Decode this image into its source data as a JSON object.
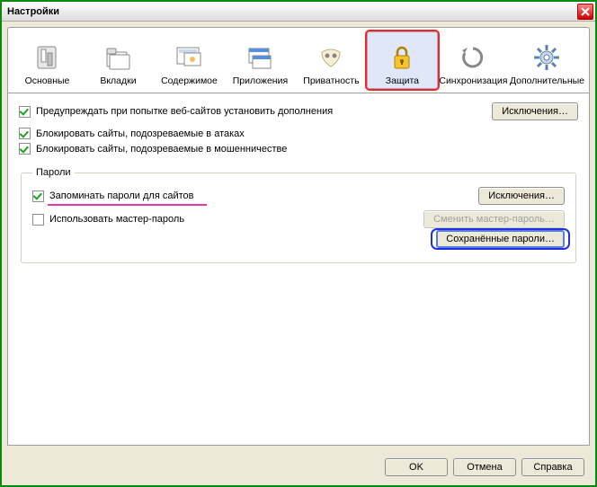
{
  "window": {
    "title": "Настройки"
  },
  "tabs": [
    {
      "label": "Основные"
    },
    {
      "label": "Вкладки"
    },
    {
      "label": "Содержимое"
    },
    {
      "label": "Приложения"
    },
    {
      "label": "Приватность"
    },
    {
      "label": "Защита"
    },
    {
      "label": "Синхронизация"
    },
    {
      "label": "Дополнительные"
    }
  ],
  "general": {
    "warn_addons": "Предупреждать при попытке веб-сайтов установить дополнения",
    "exceptions": "Исключения…",
    "block_attack": "Блокировать сайты, подозреваемые в атаках",
    "block_fraud": "Блокировать сайты, подозреваемые в мошенничестве"
  },
  "passwords": {
    "legend": "Пароли",
    "remember": "Запоминать пароли для сайтов",
    "exceptions": "Исключения…",
    "use_master": "Использовать мастер-пароль",
    "change_master": "Сменить мастер-пароль…",
    "saved": "Сохранённые пароли…"
  },
  "footer": {
    "ok": "OK",
    "cancel": "Отмена",
    "help": "Справка"
  }
}
